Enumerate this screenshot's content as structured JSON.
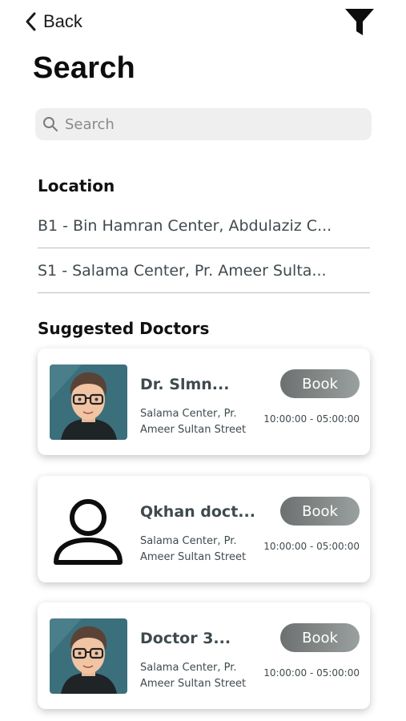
{
  "nav": {
    "back_label": "Back",
    "filter_icon": "filter-icon"
  },
  "page": {
    "title": "Search"
  },
  "search": {
    "placeholder": "Search",
    "value": ""
  },
  "location": {
    "title": "Location",
    "items": [
      "B1 - Bin Hamran Center, Abdulaziz C...",
      "S1 - Salama Center, Pr. Ameer Sulta..."
    ]
  },
  "suggested": {
    "title": "Suggested Doctors",
    "doctors": [
      {
        "name": "Dr. Slmn...",
        "address_line1": "Salama Center, Pr.",
        "address_line2": "Ameer Sultan Street",
        "time": "10:00:00 - 05:00:00",
        "book_label": "Book",
        "avatar": "cartoon-avatar"
      },
      {
        "name": "Qkhan doct...",
        "address_line1": "Salama Center, Pr.",
        "address_line2": "Ameer Sultan Street",
        "time": "10:00:00 - 05:00:00",
        "book_label": "Book",
        "avatar": "person-outline-icon"
      },
      {
        "name": "Doctor 3...",
        "address_line1": "Salama Center, Pr.",
        "address_line2": "Ameer Sultan Street",
        "time": "10:00:00 - 05:00:00",
        "book_label": "Book",
        "avatar": "cartoon-avatar"
      }
    ]
  },
  "colors": {
    "text_primary": "#111111",
    "text_secondary": "#3f4a4e",
    "search_bg": "#efefef",
    "button_gradient_start": "#6d7070",
    "button_gradient_end": "#9aa09f",
    "avatar_bg": "#3b6f7c"
  }
}
